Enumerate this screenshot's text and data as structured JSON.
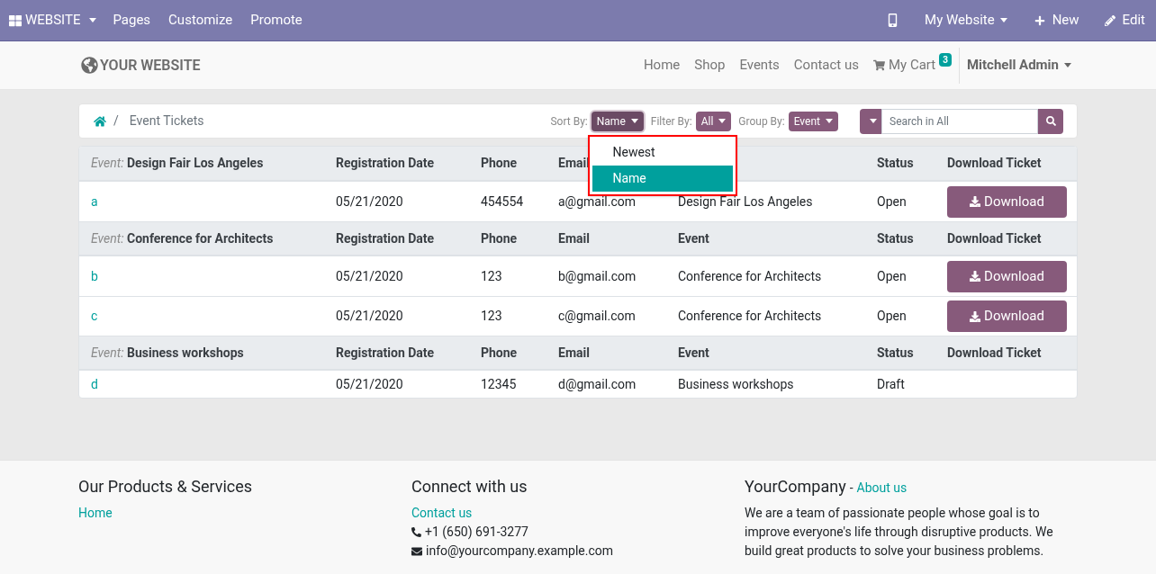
{
  "admin_bar": {
    "app_menu": "WEBSITE",
    "items": [
      "Pages",
      "Customize",
      "Promote"
    ],
    "website_menu": "My Website",
    "new": "New",
    "edit": "Edit"
  },
  "navbar": {
    "logo": "YOUR WEBSITE",
    "links": [
      {
        "label": "Home"
      },
      {
        "label": "Shop"
      },
      {
        "label": "Events"
      },
      {
        "label": "Contact us"
      }
    ],
    "cart": {
      "label": "My Cart",
      "count": "3"
    },
    "user": "Mitchell Admin"
  },
  "breadcrumb": {
    "separator": "/",
    "current": "Event Tickets"
  },
  "controls": {
    "sort": {
      "label": "Sort By:",
      "value": "Name",
      "open": true,
      "options": [
        {
          "label": "Newest",
          "selected": false
        },
        {
          "label": "Name",
          "selected": true
        }
      ]
    },
    "filter": {
      "label": "Filter By:",
      "value": "All"
    },
    "group": {
      "label": "Group By:",
      "value": "Event"
    },
    "search": {
      "placeholder": "Search in All"
    }
  },
  "groups": [
    {
      "prefix": "Event:",
      "name": "Design Fair Los Angeles",
      "columns": [
        {
          "kind": "date",
          "label": "Registration Date"
        },
        {
          "kind": "phone",
          "label": "Phone"
        },
        {
          "kind": "email",
          "label": "Email"
        },
        {
          "kind": "status",
          "label": "Status"
        },
        {
          "kind": "download",
          "label": "Download Ticket"
        }
      ],
      "rows": [
        {
          "name": "a",
          "date": "05/21/2020",
          "phone": "454554",
          "email": "a@gmail.com",
          "event": "Design Fair Los Angeles",
          "status": "Open",
          "download": "Download"
        }
      ]
    },
    {
      "prefix": "Event:",
      "name": "Conference for Architects",
      "columns": [
        {
          "kind": "date",
          "label": "Registration Date"
        },
        {
          "kind": "phone",
          "label": "Phone"
        },
        {
          "kind": "email",
          "label": "Email"
        },
        {
          "kind": "event",
          "label": "Event"
        },
        {
          "kind": "status",
          "label": "Status"
        },
        {
          "kind": "download",
          "label": "Download Ticket"
        }
      ],
      "rows": [
        {
          "name": "b",
          "date": "05/21/2020",
          "phone": "123",
          "email": "b@gmail.com",
          "event": "Conference for Architects",
          "status": "Open",
          "download": "Download"
        },
        {
          "name": "c",
          "date": "05/21/2020",
          "phone": "123",
          "email": "c@gmail.com",
          "event": "Conference for Architects",
          "status": "Open",
          "download": "Download"
        }
      ]
    },
    {
      "prefix": "Event:",
      "name": "Business workshops",
      "columns": [
        {
          "kind": "date",
          "label": "Registration Date"
        },
        {
          "kind": "phone",
          "label": "Phone"
        },
        {
          "kind": "email",
          "label": "Email"
        },
        {
          "kind": "event",
          "label": "Event"
        },
        {
          "kind": "status",
          "label": "Status"
        },
        {
          "kind": "download",
          "label": "Download Ticket"
        }
      ],
      "rows": [
        {
          "name": "d",
          "date": "05/21/2020",
          "phone": "12345",
          "email": "d@gmail.com",
          "event": "Business workshops",
          "status": "Draft"
        }
      ]
    }
  ],
  "footer": {
    "products": {
      "title": "Our Products & Services",
      "links": [
        "Home"
      ]
    },
    "connect": {
      "title": "Connect with us",
      "link": "Contact us",
      "phone": "+1 (650) 691-3277",
      "email": "info@yourcompany.example.com"
    },
    "about": {
      "title": "YourCompany",
      "separator": "-",
      "link": "About us",
      "text": "We are a team of passionate people whose goal is to improve everyone's life through disruptive products. We build great products to solve your business problems."
    }
  }
}
